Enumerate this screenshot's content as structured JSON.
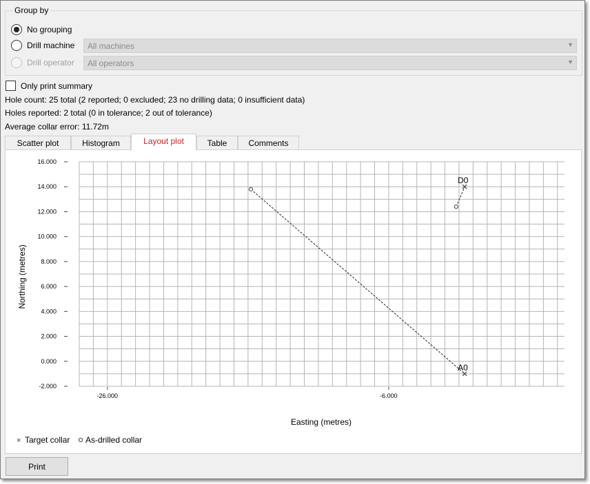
{
  "group_by": {
    "title": "Group by",
    "no_grouping_label": "No grouping",
    "drill_machine_label": "Drill machine",
    "drill_machine_value": "All machines",
    "drill_operator_label": "Drill operator",
    "drill_operator_value": "All operators"
  },
  "only_print_summary_label": "Only print summary",
  "hole_count_text": "Hole count: 25 total (2 reported; 0 excluded; 23 no drilling data; 0 insufficient data)",
  "holes_reported_text": "Holes reported: 2 total (0 in tolerance; 2 out of tolerance)",
  "average_collar_error_text": "Average collar error: 11.72m",
  "tabs": [
    {
      "label": "Scatter plot"
    },
    {
      "label": "Histogram"
    },
    {
      "label": "Layout plot"
    },
    {
      "label": "Table"
    },
    {
      "label": "Comments"
    }
  ],
  "active_tab": "Layout plot",
  "print_label": "Print",
  "colors": {
    "active_tab": "#d02020",
    "grid": "#b4b4b4",
    "marker": "#30405a"
  },
  "icons": {
    "combo_arrow": "chevron-down-icon",
    "target_marker": "x-icon",
    "drilled_marker": "circle-icon"
  },
  "chart_data": {
    "type": "scatter",
    "xlabel": "Easting (metres)",
    "ylabel": "Northing (metres)",
    "xlim": [
      -28,
      6.5
    ],
    "ylim": [
      -2,
      16
    ],
    "x_ticks": [
      -26,
      -6
    ],
    "x_tick_labels": [
      "-26.000",
      "-6.000"
    ],
    "y_ticks": [
      -2,
      0,
      2,
      4,
      6,
      8,
      10,
      12,
      14,
      16
    ],
    "y_tick_labels": [
      "-2.000",
      "0.000",
      "2.000",
      "4.000",
      "6.000",
      "8.000",
      "10.000",
      "12.000",
      "14.000",
      "16.000"
    ],
    "x_grid_step": 1,
    "y_grid_step": 1,
    "grid": true,
    "legend": {
      "position": "bottom-left",
      "target_label": "Target collar",
      "drilled_label": "As-drilled collar"
    },
    "holes": [
      {
        "name": "A0",
        "target": {
          "x": -0.6,
          "y": -1.0
        },
        "drilled": {
          "x": -15.8,
          "y": 13.8
        }
      },
      {
        "name": "D0",
        "target": {
          "x": -0.6,
          "y": 14.0
        },
        "drilled": {
          "x": -1.2,
          "y": 12.4
        }
      }
    ]
  }
}
